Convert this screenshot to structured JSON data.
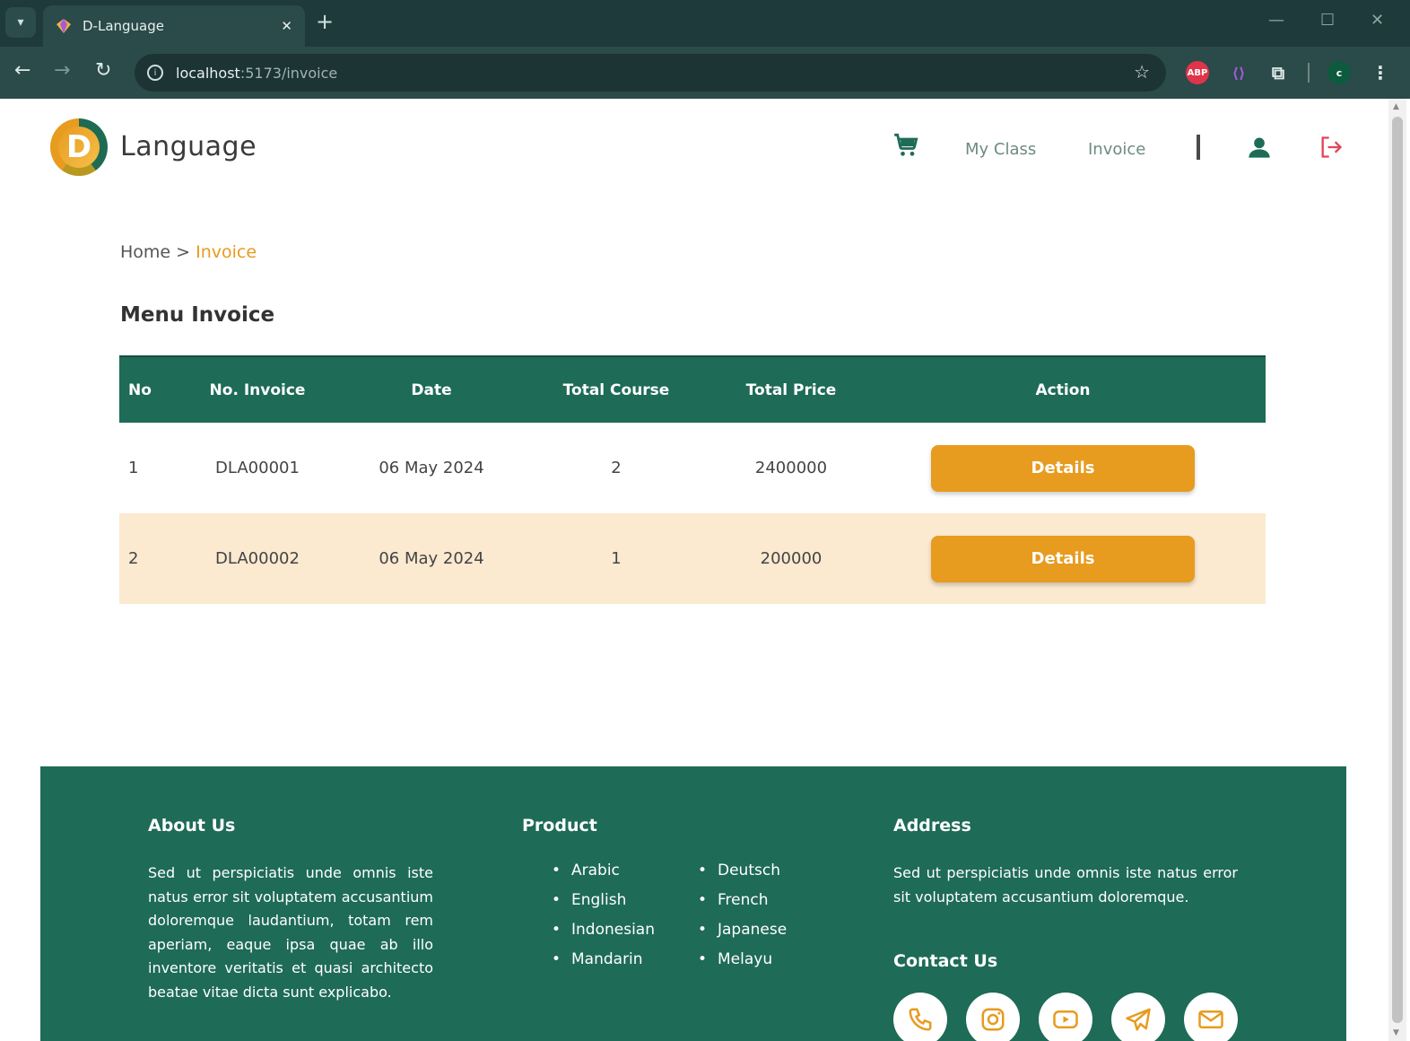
{
  "browser": {
    "tab_title": "D-Language",
    "tab_close": "✕",
    "new_tab": "+",
    "url_host": "localhost",
    "url_path": ":5173/invoice",
    "ext_abp_label": "ABP",
    "profile_initial": "c"
  },
  "header": {
    "logo_letter": "D",
    "logo_text": "Language",
    "nav": {
      "my_class": "My Class",
      "invoice": "Invoice"
    }
  },
  "breadcrumb": {
    "home": "Home",
    "separator": " > ",
    "current": "Invoice"
  },
  "page": {
    "title": "Menu Invoice"
  },
  "table": {
    "headers": {
      "no": "No",
      "invoice": "No. Invoice",
      "date": "Date",
      "total_course": "Total Course",
      "total_price": "Total Price",
      "action": "Action"
    },
    "rows": [
      {
        "no": "1",
        "invoice": "DLA00001",
        "date": "06 May 2024",
        "total_course": "2",
        "total_price": "2400000",
        "action": "Details"
      },
      {
        "no": "2",
        "invoice": "DLA00002",
        "date": "06 May 2024",
        "total_course": "1",
        "total_price": "200000",
        "action": "Details"
      }
    ]
  },
  "footer": {
    "about_title": "About Us",
    "about_text": "Sed ut perspiciatis unde omnis iste natus error sit voluptatem accusantium doloremque laudantium, totam rem aperiam, eaque ipsa quae ab illo inventore veritatis et quasi architecto beatae vitae dicta sunt explicabo.",
    "product_title": "Product",
    "products_left": [
      "Arabic",
      "English",
      "Indonesian",
      "Mandarin"
    ],
    "products_right": [
      "Deutsch",
      "French",
      "Japanese",
      "Melayu"
    ],
    "address_title": "Address",
    "address_text": "Sed ut perspiciatis unde omnis iste natus error sit voluptatem accusantium doloremque.",
    "contact_title": "Contact Us"
  },
  "colors": {
    "primary_green": "#1e6b57",
    "accent_orange": "#e79b1f",
    "row_highlight": "#fbe9d0"
  }
}
